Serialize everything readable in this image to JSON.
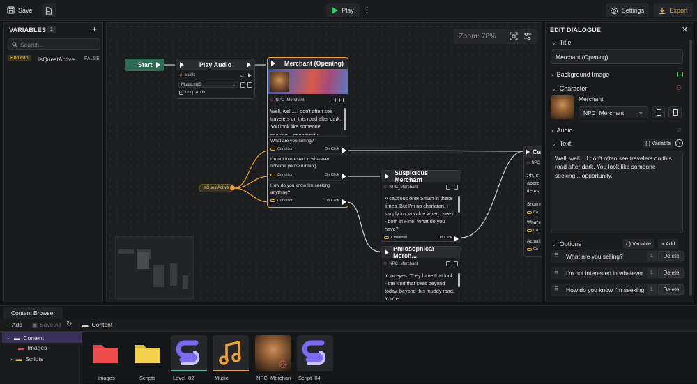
{
  "topbar": {
    "save_label": "Save",
    "play_label": "Play",
    "settings_label": "Settings",
    "export_label": "Export"
  },
  "variables": {
    "title": "VARIABLES",
    "count": "1",
    "add": "+",
    "search_placeholder": "Search...",
    "items": [
      {
        "type": "Boolean",
        "name": "isQuestActive",
        "value": "FALSE"
      }
    ]
  },
  "canvas": {
    "zoom": "Zoom: 78%",
    "start_label": "Start",
    "play_audio": {
      "title": "Play Audio",
      "section": "Music",
      "file": "Music.mp3",
      "loop": "Loop Audio"
    },
    "merchant": {
      "title": "Merchant (Opening)",
      "npc": "NPC_Merchant",
      "text": "Well, well... I don't often see travelers on this road after dark. You look like someone seeking... opportunity.",
      "options": [
        {
          "text": "What are you selling?",
          "cond": "Condition",
          "on": "On Click"
        },
        {
          "text": "I'm not interested in whatever scheme you're running.",
          "cond": "Condition",
          "on": "On Click"
        },
        {
          "text": "How do you know I'm seeking anything?",
          "cond": "Condition",
          "on": "On Click"
        }
      ]
    },
    "variable_node": "isQuestActive",
    "suspicious": {
      "title": "Suspicious Merchant",
      "npc": "NPC_Merchant",
      "text": "A cautious one! Smart in these times. But I'm no charlatan. I simply know value when I see it - both in Fine. What do you have?",
      "cond": "Condition",
      "on": "On Click"
    },
    "philosophical": {
      "title": "Philosophical Merch...",
      "npc": "NPC_Merchant",
      "text": "Your eyes. They have that look - the kind that sees beyond today, beyond this muddy road. You're"
    },
    "cut_node": {
      "title": "Cu",
      "npc": "NPC",
      "text_lines": [
        "Ah, st",
        "appre",
        "items"
      ],
      "opts": [
        "Show r",
        "What's",
        "Actuall"
      ],
      "cond": "Co"
    }
  },
  "dialogue": {
    "title": "EDIT DIALOGUE",
    "title_label": "Title",
    "title_value": "Merchant (Opening)",
    "background_label": "Background Image",
    "character_label": "Character",
    "character_name": "Merchant",
    "character_select": "NPC_Merchant",
    "audio_label": "Audio",
    "text_label": "Text",
    "variable_btn": "{ } Variable",
    "text_value": "Well, well... I don't often see travelers on this road after dark. You look like someone seeking... opportunity.",
    "options_label": "Options",
    "options_variable": "{ } Variable",
    "options_add": "+ Add",
    "options": [
      {
        "text": "What are you selling?",
        "count": "1",
        "delete": "Delete"
      },
      {
        "text": "I'm not interested in whatever",
        "count": "1",
        "delete": "Delete"
      },
      {
        "text": "How do you know I'm seeking",
        "count": "1",
        "delete": "Delete"
      }
    ]
  },
  "content": {
    "tab": "Content Browser",
    "add": "Add",
    "save_all": "Save All",
    "path": "Content",
    "tree": [
      {
        "label": "Content"
      },
      {
        "label": "Images"
      },
      {
        "label": "Scripts"
      }
    ],
    "assets": [
      {
        "label": "Images"
      },
      {
        "label": "Scripts"
      },
      {
        "label": "Level_02"
      },
      {
        "label": "Music"
      },
      {
        "label": "NPC_Merchan"
      },
      {
        "label": "Script_04"
      }
    ]
  },
  "colors": {
    "accent": "#e8a33a",
    "play": "#3ec46d",
    "start_node": "#2f6b55",
    "selected": "#3b2f5c"
  }
}
